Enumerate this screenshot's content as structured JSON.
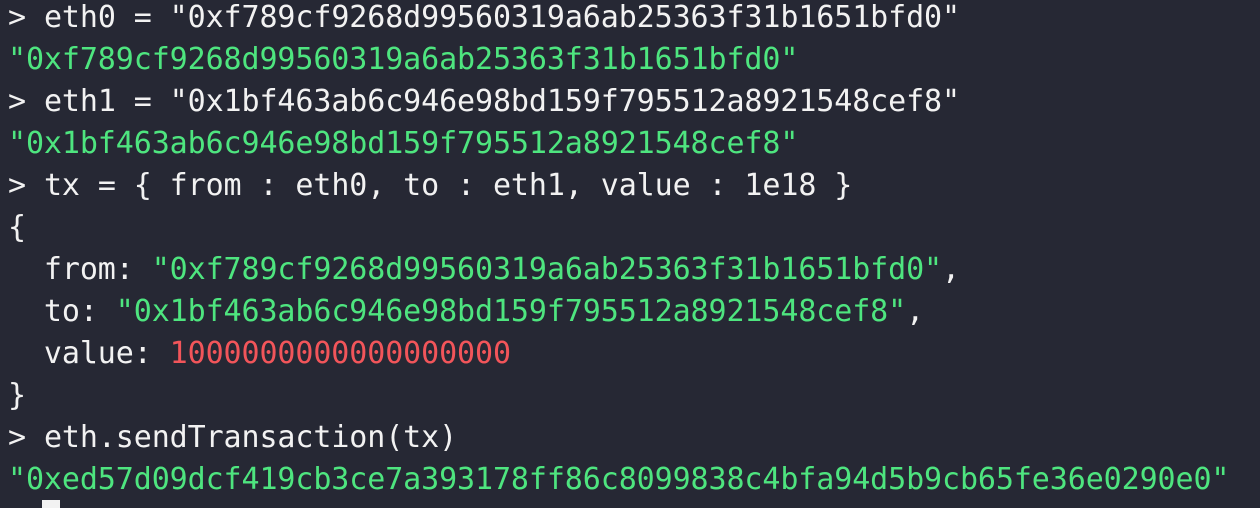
{
  "terminal": {
    "lines": [
      {
        "prompt": "> ",
        "command": "eth0 = \"0xf789cf9268d99560319a6ab25363f31b1651bfd0\""
      },
      {
        "output": "\"0xf789cf9268d99560319a6ab25363f31b1651bfd0\""
      },
      {
        "prompt": "> ",
        "command": "eth1 = \"0x1bf463ab6c946e98bd159f795512a8921548cef8\""
      },
      {
        "output": "\"0x1bf463ab6c946e98bd159f795512a8921548cef8\""
      },
      {
        "prompt": "> ",
        "command": "tx = { from : eth0, to : eth1, value : 1e18 }"
      },
      {
        "brace_open": "{"
      },
      {
        "key": "  from: ",
        "value": "\"0xf789cf9268d99560319a6ab25363f31b1651bfd0\"",
        "suffix": ","
      },
      {
        "key": "  to: ",
        "value": "\"0x1bf463ab6c946e98bd159f795512a8921548cef8\"",
        "suffix": ","
      },
      {
        "key": "  value: ",
        "value": "1000000000000000000",
        "suffix": ""
      },
      {
        "brace_close": "}"
      },
      {
        "prompt": "> ",
        "command": "eth.sendTransaction(tx)"
      },
      {
        "output": "\"0xed57d09dcf419cb3ce7a393178ff86c8099838c4bfa94d5b9cb65fe36e0290e0\""
      }
    ],
    "colors": {
      "background": "#262834",
      "text": "#f2f2f2",
      "string": "#4ee57f",
      "number": "#f2555a"
    }
  }
}
